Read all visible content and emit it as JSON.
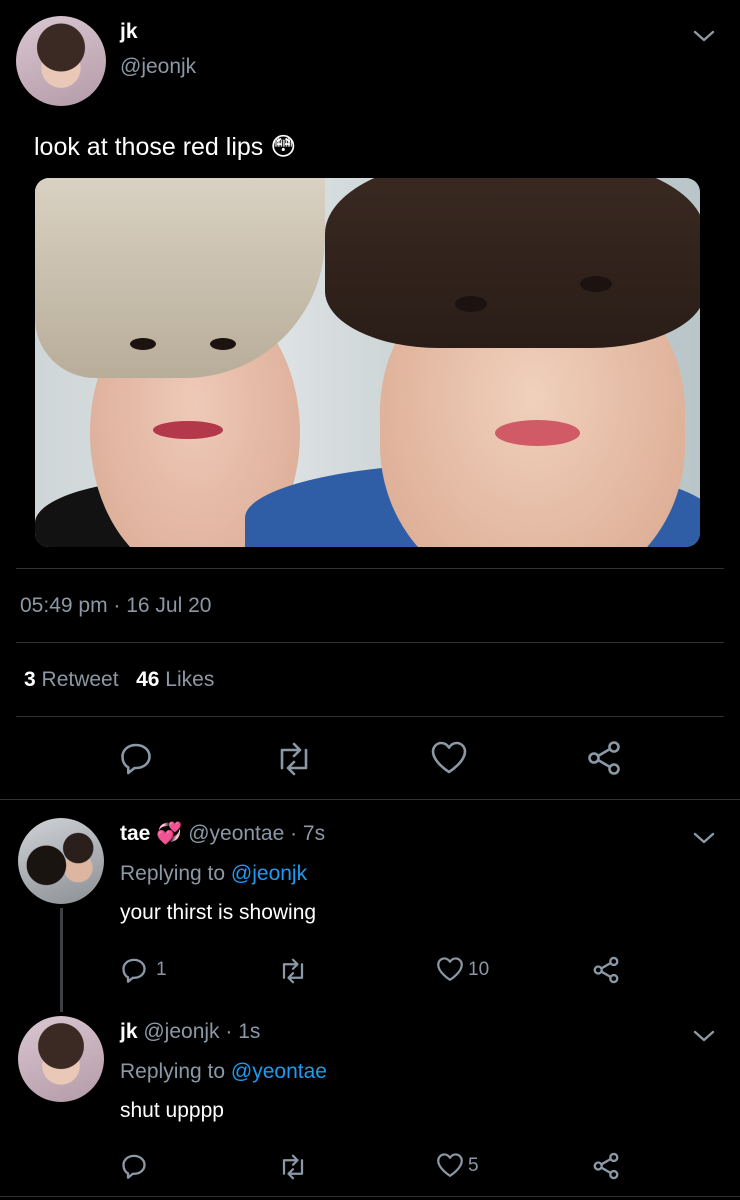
{
  "tweet": {
    "author_name": "jk",
    "author_handle": "@jeonjk",
    "text": "look at those red lips",
    "emoji": "😳",
    "timestamp": "05:49 pm · 16 Jul 20",
    "retweet_count": "3",
    "retweet_label": "Retweet",
    "like_count": "46",
    "like_label": "Likes"
  },
  "replies": [
    {
      "name": "tae",
      "badge": "💞",
      "handle": "@yeontae",
      "time": "· 7s",
      "replying_prefix": "Replying to",
      "replying_to": "@jeonjk",
      "text": "your thirst is showing",
      "reply_count": "1",
      "like_count": "10"
    },
    {
      "name": "jk",
      "handle": "@jeonjk",
      "time": "· 1s",
      "replying_prefix": "Replying to",
      "replying_to": "@yeontae",
      "text": "shut upppp",
      "reply_count": "",
      "like_count": "5"
    }
  ],
  "icons": [
    "chevron-down-icon",
    "reply-icon",
    "retweet-icon",
    "like-icon",
    "share-icon"
  ],
  "colors": {
    "background": "#000000",
    "link": "#1d9bf0",
    "muted": "#8b98a5",
    "divider": "#2f3336"
  }
}
